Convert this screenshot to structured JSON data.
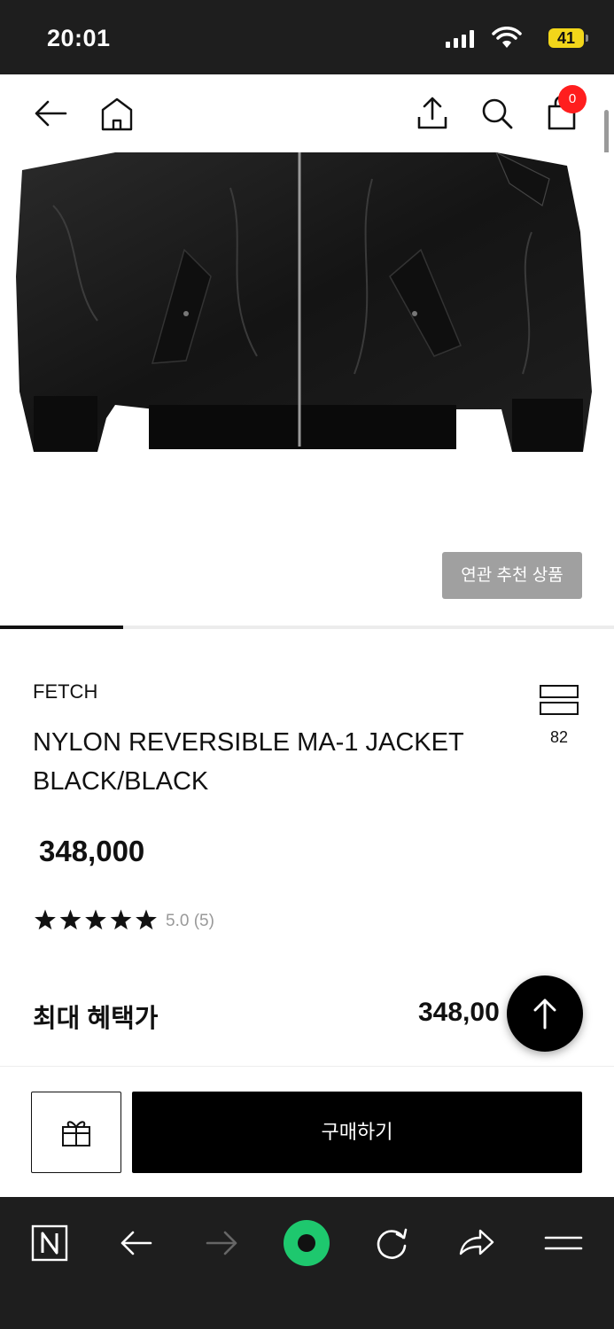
{
  "status_bar": {
    "time": "20:01",
    "battery": "41"
  },
  "nav": {
    "cart_count": "0"
  },
  "gallery": {
    "related_button": "연관 추천 상품",
    "progress": 0.2
  },
  "product": {
    "brand": "FETCH",
    "name_line1": "NYLON REVERSIBLE MA-1 JACKET",
    "name_line2": "BLACK/BLACK",
    "compare_count": "82",
    "price": "348,000",
    "rating_text": "5.0 (5)",
    "rating_value": 5
  },
  "benefit": {
    "label": "최대 혜택가",
    "value": "348,00"
  },
  "actions": {
    "buy_label": "구매하기"
  },
  "colors": {
    "accent": "#000000",
    "badge": "#ff1e1e",
    "browser_green": "#1ec86e"
  }
}
